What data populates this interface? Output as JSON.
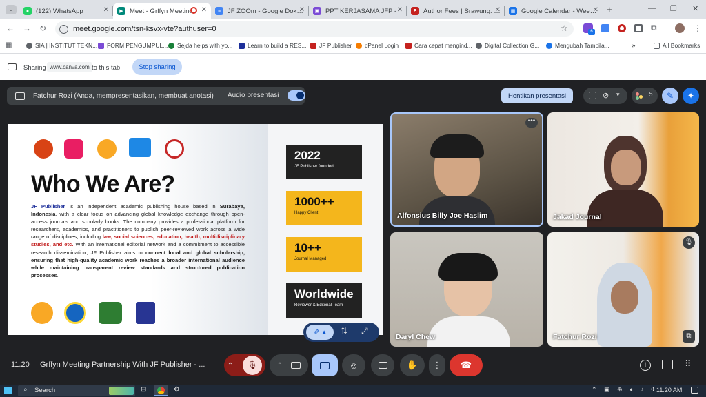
{
  "browser": {
    "tabs": [
      {
        "title": "(122) WhatsApp",
        "color": "#25d366"
      },
      {
        "title": "Meet - Grffyn Meeting",
        "color": "#00897b",
        "active": true
      },
      {
        "title": "JF ZOOm - Google Dokum",
        "color": "#4285f4"
      },
      {
        "title": "PPT KERJASAMA JFP -",
        "color": "#7b4bd6"
      },
      {
        "title": "Author Fees | Srawung: Jou",
        "color": "#c5221f"
      },
      {
        "title": "Google Calendar - Week o",
        "color": "#1a73e8"
      }
    ],
    "url": "meet.google.com/tsn-ksvx-vte?authuser=0",
    "bookmarks": [
      "SIA | INSTITUT TEKN...",
      "FORM PENGUMPUL...",
      "Sejda helps with yo...",
      "Learn to build a RES...",
      "JF Publisher",
      "cPanel Login",
      "Cara cepat mengind...",
      "Digital Collection G...",
      "Mengubah Tampila..."
    ],
    "all_bookmarks": "All Bookmarks",
    "ext_badge": "6"
  },
  "sharebar": {
    "sharing": "Sharing",
    "site": "www.canva.com",
    "to_tab": "to this tab",
    "stop": "Stop sharing"
  },
  "meet": {
    "presenter": "Fatchur Rozi (Anda, mempresentasikan, membuat anotasi)",
    "audio": "Audio presentasi",
    "stop_presenting": "Hentikan presentasi",
    "participants_count": "5",
    "time": "11.20",
    "meeting_title": "Grffyn Meeting Partnership With JF Publisher - ...",
    "participants": [
      "Alfonsius Billy Joe Haslim",
      "Jakad Journal",
      "Daryl Chew",
      "Fatchur Rozi"
    ]
  },
  "slide": {
    "heading": "Who We Are?",
    "body_parts": {
      "p1_blue": "JF Publisher",
      "p1": " is an independent academic publishing house based in ",
      "p2_bold": "Surabaya, Indonesia",
      "p2": ", with a clear focus on advancing global knowledge exchange through open-access journals and scholarly books. The company provides a professional platform for researchers, academics, and practitioners to publish peer-reviewed work across a wide range of disciplines, including ",
      "p3_red": "law, social sciences, education, health, multidisciplinary studies, and etc.",
      "p3": " With an international editorial network and a commitment to accessible research dissemination, JF Publisher aims to ",
      "p4_bold": "connect local and global scholarship, ensuring that high-quality academic work reaches a broader international audience while maintaining transparent review standards and structured publication processes",
      "p4": "."
    },
    "stats": [
      {
        "num": "2022",
        "label": "JF Publisher founded"
      },
      {
        "num": "1000++",
        "label": "Happy Client"
      },
      {
        "num": "10++",
        "label": "Journal Managed"
      },
      {
        "num": "Worldwide",
        "label": "Reviewer & Editorial Team"
      }
    ]
  },
  "taskbar": {
    "search": "Search",
    "time": "11:20 AM"
  }
}
